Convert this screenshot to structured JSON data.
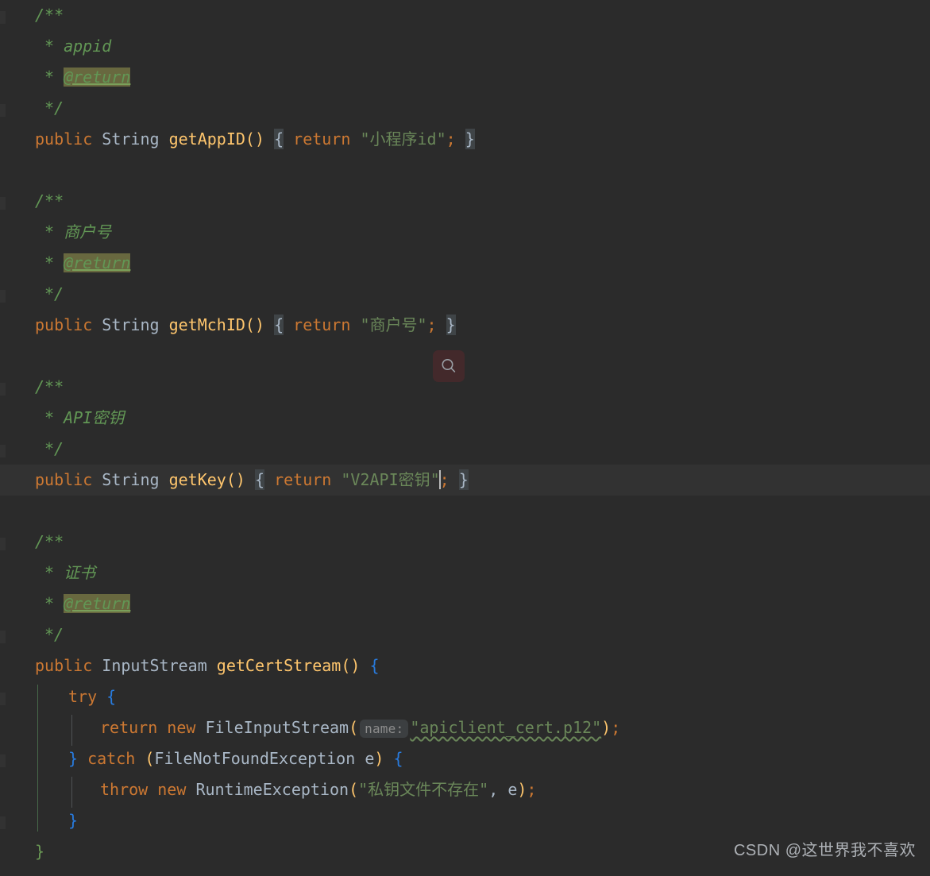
{
  "editor": {
    "theme_name": "darcula",
    "background": "#2b2b2b",
    "current_line_background": "#323232",
    "caret_color": "#bbbbbb",
    "colors": {
      "keyword": "#cc7832",
      "string": "#6a8759",
      "method": "#ffc66d",
      "comment": "#629755",
      "identifier": "#a9b7c6",
      "brace": "#287bde",
      "fold_brace": "#6a9955",
      "javadoc_tag_highlight": "#68683f",
      "inlay_hint_bg": "#3c3f41"
    }
  },
  "lines": [
    {
      "n": 1,
      "indent": 1,
      "kind": "comment",
      "text": "/**"
    },
    {
      "n": 2,
      "indent": 1,
      "kind": "comment",
      "text": "* appid"
    },
    {
      "n": 3,
      "indent": 1,
      "kind": "comment-tag",
      "text": "* @return",
      "tag": "@return"
    },
    {
      "n": 4,
      "indent": 1,
      "kind": "comment",
      "text": "*/"
    },
    {
      "n": 5,
      "indent": 1,
      "kind": "code",
      "text": "public String getAppID() { return \"小程序id\"; }"
    },
    {
      "n": 6,
      "indent": 0,
      "kind": "blank",
      "text": ""
    },
    {
      "n": 7,
      "indent": 1,
      "kind": "comment",
      "text": "/**"
    },
    {
      "n": 8,
      "indent": 1,
      "kind": "comment",
      "text": "* 商户号"
    },
    {
      "n": 9,
      "indent": 1,
      "kind": "comment-tag",
      "text": "* @return",
      "tag": "@return"
    },
    {
      "n": 10,
      "indent": 1,
      "kind": "comment",
      "text": "*/"
    },
    {
      "n": 11,
      "indent": 1,
      "kind": "code",
      "text": "public String getMchID() { return \"商户号\"; }"
    },
    {
      "n": 12,
      "indent": 0,
      "kind": "blank",
      "text": ""
    },
    {
      "n": 13,
      "indent": 1,
      "kind": "comment",
      "text": "/**"
    },
    {
      "n": 14,
      "indent": 1,
      "kind": "comment",
      "text": "* API密钥"
    },
    {
      "n": 15,
      "indent": 1,
      "kind": "comment",
      "text": "*/"
    },
    {
      "n": 16,
      "indent": 1,
      "kind": "code",
      "current": true,
      "text": "public String getKey() { return \"V2API密钥\"; }"
    },
    {
      "n": 17,
      "indent": 0,
      "kind": "blank",
      "text": ""
    },
    {
      "n": 18,
      "indent": 1,
      "kind": "comment",
      "text": "/**"
    },
    {
      "n": 19,
      "indent": 1,
      "kind": "comment",
      "text": "* 证书"
    },
    {
      "n": 20,
      "indent": 1,
      "kind": "comment-tag",
      "text": "* @return",
      "tag": "@return"
    },
    {
      "n": 21,
      "indent": 1,
      "kind": "comment",
      "text": "*/"
    },
    {
      "n": 22,
      "indent": 1,
      "kind": "code",
      "text": "public InputStream getCertStream() {"
    },
    {
      "n": 23,
      "indent": 2,
      "kind": "code",
      "text": "try {"
    },
    {
      "n": 24,
      "indent": 3,
      "kind": "code",
      "text": "return new FileInputStream( name: \"apiclient_cert.p12\");"
    },
    {
      "n": 25,
      "indent": 2,
      "kind": "code",
      "text": "} catch (FileNotFoundException e) {"
    },
    {
      "n": 26,
      "indent": 3,
      "kind": "code",
      "text": "throw new RuntimeException(\"私钥文件不存在\", e);"
    },
    {
      "n": 27,
      "indent": 2,
      "kind": "code",
      "text": "}"
    },
    {
      "n": 28,
      "indent": 1,
      "kind": "code",
      "text": "}"
    }
  ],
  "tokens": {
    "comment_open": "/**",
    "comment_close": "*/",
    "asterisk": "*",
    "javadoc_tag": "@return",
    "doc_appid": "appid",
    "doc_mchid": "商户号",
    "doc_apikey": "API密钥",
    "doc_cert": "证书",
    "kw_public": "public",
    "kw_return": "return",
    "kw_new": "new",
    "kw_try": "try",
    "kw_catch": "catch",
    "kw_throw": "throw",
    "type_string": "String",
    "type_inputstream": "InputStream",
    "type_fileinputstream": "FileInputStream",
    "type_filenotfoundexception": "FileNotFoundException",
    "type_runtimeexception": "RuntimeException",
    "m_getappid": "getAppID",
    "m_getmchid": "getMchID",
    "m_getkey": "getKey",
    "m_getcertstream": "getCertStream",
    "s_appid": "\"小程序id\"",
    "s_mchid": "\"商户号\"",
    "s_key": "\"V2API密钥\"",
    "s_certfile": "\"apiclient_cert.p12\"",
    "s_errmsg": "\"私钥文件不存在\"",
    "var_e": "e",
    "inlay_name": "name:",
    "lbrace": "{",
    "rbrace": "}",
    "lparen": "(",
    "rparen": ")",
    "paren_pair": "()",
    "semicolon": ";",
    "comma": ","
  },
  "overlay": {
    "search_icon": "search-icon",
    "search_chip_background": "#43292b"
  },
  "watermark": {
    "text": "CSDN @这世界我不喜欢"
  }
}
